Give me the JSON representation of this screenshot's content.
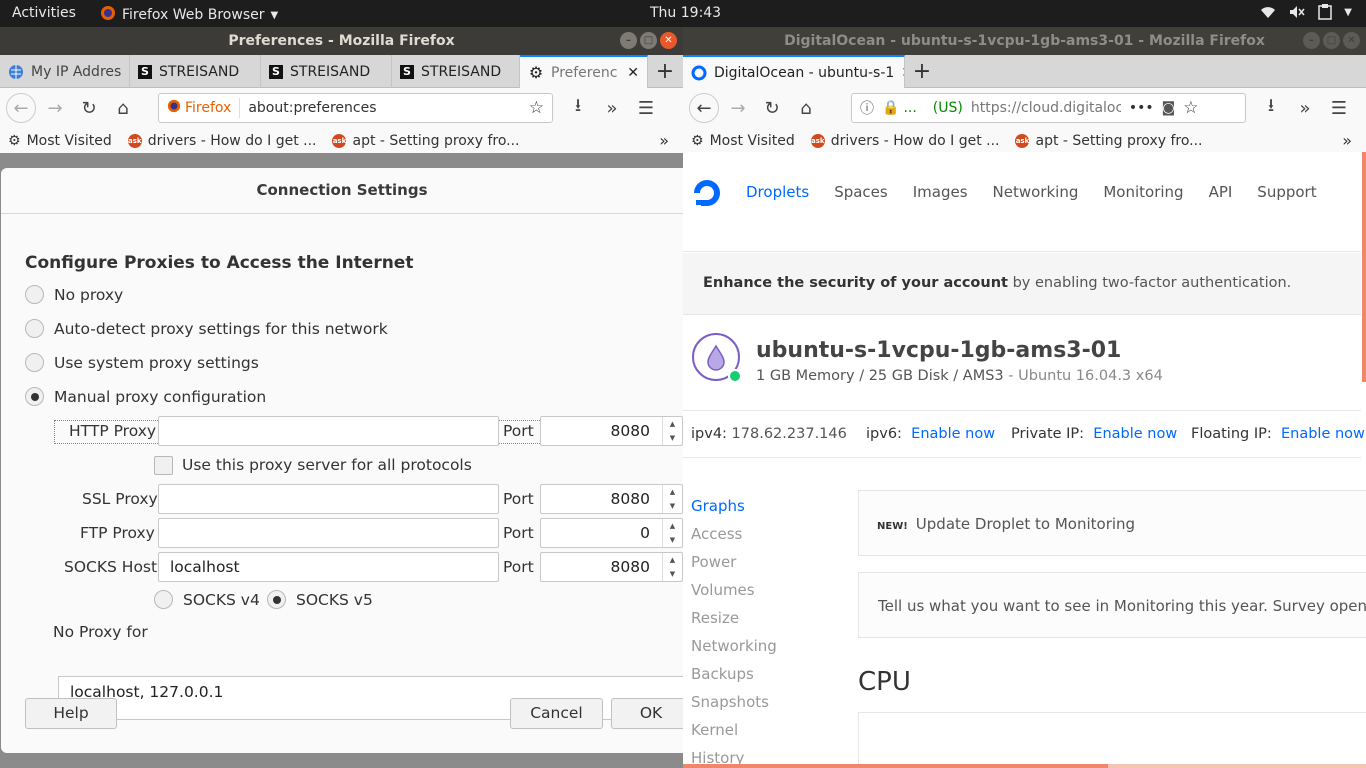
{
  "topbar": {
    "activities": "Activities",
    "app_name": "Firefox Web Browser",
    "clock": "Thu 19:43"
  },
  "left": {
    "window_title": "Preferences - Mozilla Firefox",
    "tabs": [
      {
        "label": "My IP Addres"
      },
      {
        "label": "STREISAND"
      },
      {
        "label": "STREISAND"
      },
      {
        "label": "STREISAND"
      },
      {
        "label": "Preferenc"
      }
    ],
    "url_identity": "Firefox",
    "url": "about:preferences",
    "bookmarks": [
      "Most Visited",
      "drivers - How do I get ...",
      "apt - Setting proxy fro..."
    ],
    "dialog": {
      "title": "Connection Settings",
      "heading": "Configure Proxies to Access the Internet",
      "options": [
        "No proxy",
        "Auto-detect proxy settings for this network",
        "Use system proxy settings",
        "Manual proxy configuration"
      ],
      "selected_option": "Manual proxy configuration",
      "http_label": "HTTP Proxy",
      "http_value": "",
      "http_port": "8080",
      "port_label": "Port",
      "all_protocols": "Use this proxy server for all protocols",
      "ssl_label": "SSL Proxy",
      "ssl_value": "",
      "ssl_port": "8080",
      "ftp_label": "FTP Proxy",
      "ftp_value": "",
      "ftp_port": "0",
      "socks_label": "SOCKS Host",
      "socks_value": "localhost",
      "socks_port": "8080",
      "socks_v4": "SOCKS v4",
      "socks_v5": "SOCKS v5",
      "no_proxy_label": "No Proxy for",
      "no_proxy_value": "localhost, 127.0.0.1",
      "help": "Help",
      "cancel": "Cancel",
      "ok": "OK"
    }
  },
  "right": {
    "window_title": "DigitalOcean - ubuntu-s-1vcpu-1gb-ams3-01 - Mozilla Firefox",
    "tab_label": "DigitalOcean - ubuntu-s-1",
    "url_secure": "...",
    "url_org": "(US)",
    "url": "https://cloud.digitaloc",
    "bookmarks": [
      "Most Visited",
      "drivers - How do I get ...",
      "apt - Setting proxy fro..."
    ],
    "nav": [
      "Droplets",
      "Spaces",
      "Images",
      "Networking",
      "Monitoring",
      "API",
      "Support"
    ],
    "banner_bold": "Enhance the security of your account",
    "banner_rest": " by enabling two-factor authentication.",
    "droplet_name": "ubuntu-s-1vcpu-1gb-ams3-01",
    "droplet_specs": "1 GB Memory / 25 GB Disk / AMS3",
    "droplet_os": " - Ubuntu 16.04.3 x64",
    "ipv4_label": "ipv4:",
    "ipv4_value": "178.62.237.146",
    "ipv6_label": "ipv6:",
    "private_label": "Private IP:",
    "floating_label": "Floating IP:",
    "enable_now": "Enable now",
    "sidenav": [
      "Graphs",
      "Access",
      "Power",
      "Volumes",
      "Resize",
      "Networking",
      "Backups",
      "Snapshots",
      "Kernel",
      "History"
    ],
    "new_tag": "NEW!",
    "card1": "Update Droplet to Monitoring",
    "card2": "Tell us what you want to see in Monitoring this year. Survey open thro",
    "cpu_heading": "CPU",
    "accent_color": "#0069ff"
  }
}
